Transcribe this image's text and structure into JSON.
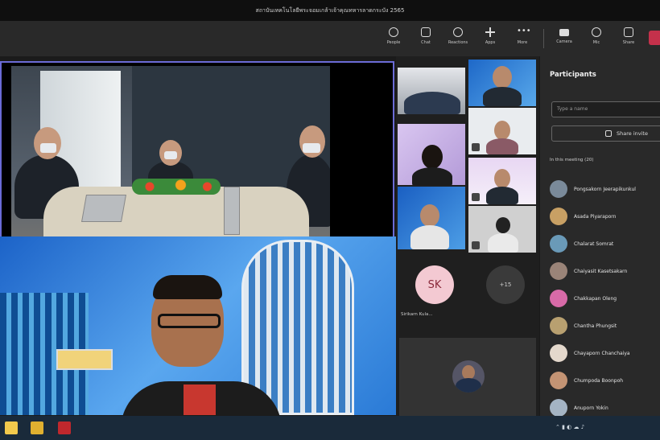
{
  "window": {
    "title": "สถาบันเทคโนโลยีพระจอมเกล้าเจ้าคุณทหารลาดกระบัง 2565"
  },
  "toolbar": {
    "timer": "",
    "items": [
      {
        "label": "People",
        "icon": "people-icon"
      },
      {
        "label": "Chat",
        "icon": "chat-icon"
      },
      {
        "label": "Reactions",
        "icon": "reactions-icon"
      },
      {
        "label": "Apps",
        "icon": "apps-icon"
      },
      {
        "label": "More",
        "icon": "more-icon"
      },
      {
        "label": "Camera",
        "icon": "camera-icon"
      },
      {
        "label": "Mic",
        "icon": "mic-icon"
      },
      {
        "label": "Share",
        "icon": "share-icon"
      }
    ]
  },
  "gallery": {
    "avatars": [
      {
        "initials": "SK",
        "name": "Sirikarn Kula...",
        "bg": "#f3c9d2",
        "fg": "#8a2a3b"
      },
      {
        "initials": "+15",
        "name": "",
        "bg": "#3a3a3a",
        "fg": "#cccccc"
      }
    ]
  },
  "panel": {
    "title": "Participants",
    "search_placeholder": "Type a name",
    "share_label": "Share invite",
    "section_label": "In this meeting (20)",
    "participants": [
      {
        "name": "Pongsakorn Jeerapikunkul"
      },
      {
        "name": "Asada Piyaraporn"
      },
      {
        "name": "Chalarat Somrat"
      },
      {
        "name": "Chaiyasit Kasetsakarn"
      },
      {
        "name": "Chakkapan Oleng"
      },
      {
        "name": "Chantha Phungsit"
      },
      {
        "name": "Chayaporn Chanchaiya"
      },
      {
        "name": "Chumpoda Boonpoh"
      },
      {
        "name": "Anuporn Yokin"
      }
    ]
  },
  "taskbar": {
    "time": ""
  }
}
